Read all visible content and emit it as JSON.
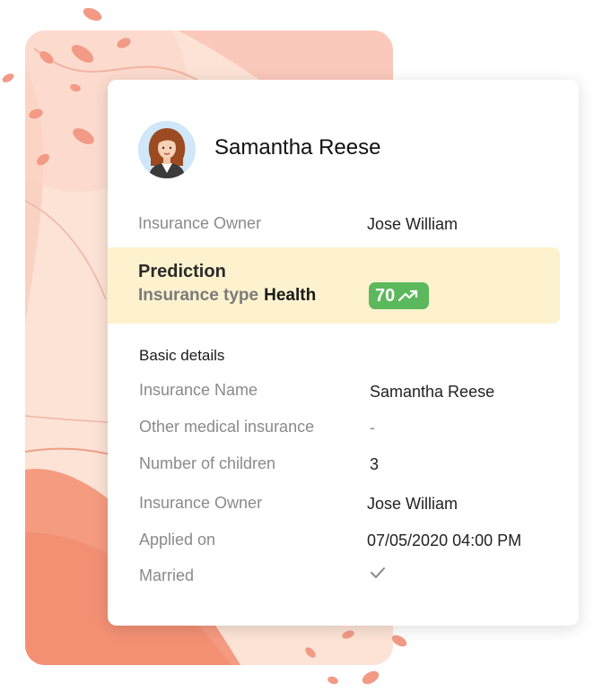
{
  "profile": {
    "name": "Samantha Reese",
    "owner_label": "Insurance Owner",
    "owner_value": "Jose William"
  },
  "prediction": {
    "title": "Prediction",
    "type_label": "Insurance type",
    "type_value": "Health",
    "score": "70",
    "trend_icon": "trending-up-icon",
    "accent_color": "#5cb85c",
    "highlight_color": "#fdf2cd"
  },
  "basic_details": {
    "title": "Basic details",
    "rows": [
      {
        "label": "Insurance Name",
        "value": "Samantha Reese"
      },
      {
        "label": "Other medical insurance",
        "value": "-"
      },
      {
        "label": "Number of children",
        "value": "3"
      },
      {
        "label": "Insurance Owner",
        "value": "Jose William"
      },
      {
        "label": "Applied on",
        "value": "07/05/2020 04:00 PM"
      },
      {
        "label": "Married",
        "value": "",
        "icon": "checkmark-icon"
      }
    ]
  },
  "colors": {
    "background_panel": "#fde0d2",
    "petal": "#f29a85"
  }
}
